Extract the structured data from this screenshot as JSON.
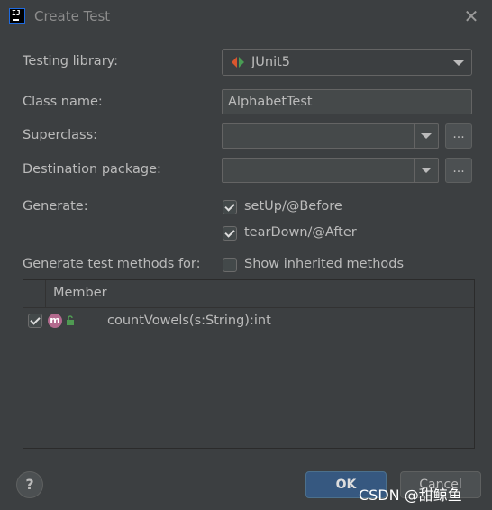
{
  "window": {
    "title": "Create Test",
    "close_icon": "close-icon"
  },
  "form": {
    "testing_library": {
      "label": "Testing library:",
      "value": "JUnit5"
    },
    "class_name": {
      "label": "Class name:",
      "value": "AlphabetTest"
    },
    "superclass": {
      "label": "Superclass:",
      "value": "",
      "browse_label": "..."
    },
    "destination_package": {
      "label": "Destination package:",
      "value": "",
      "browse_label": "..."
    },
    "generate": {
      "label": "Generate:",
      "options": [
        {
          "label": "setUp/@Before",
          "checked": true
        },
        {
          "label": "tearDown/@After",
          "checked": true
        }
      ]
    },
    "generate_methods_for": {
      "label": "Generate test methods for:",
      "show_inherited": {
        "label": "Show inherited methods",
        "checked": false
      }
    }
  },
  "members_table": {
    "header": "Member",
    "rows": [
      {
        "checked": true,
        "method_badge": "m",
        "signature": "countVowels(s:String):int"
      }
    ]
  },
  "footer": {
    "help_label": "?",
    "ok_label": "OK",
    "cancel_label": "Cancel"
  },
  "watermark": "CSDN @甜鲸鱼",
  "colors": {
    "background": "#3c3f41",
    "primary_button": "#365880",
    "text": "#bbbbbb"
  }
}
